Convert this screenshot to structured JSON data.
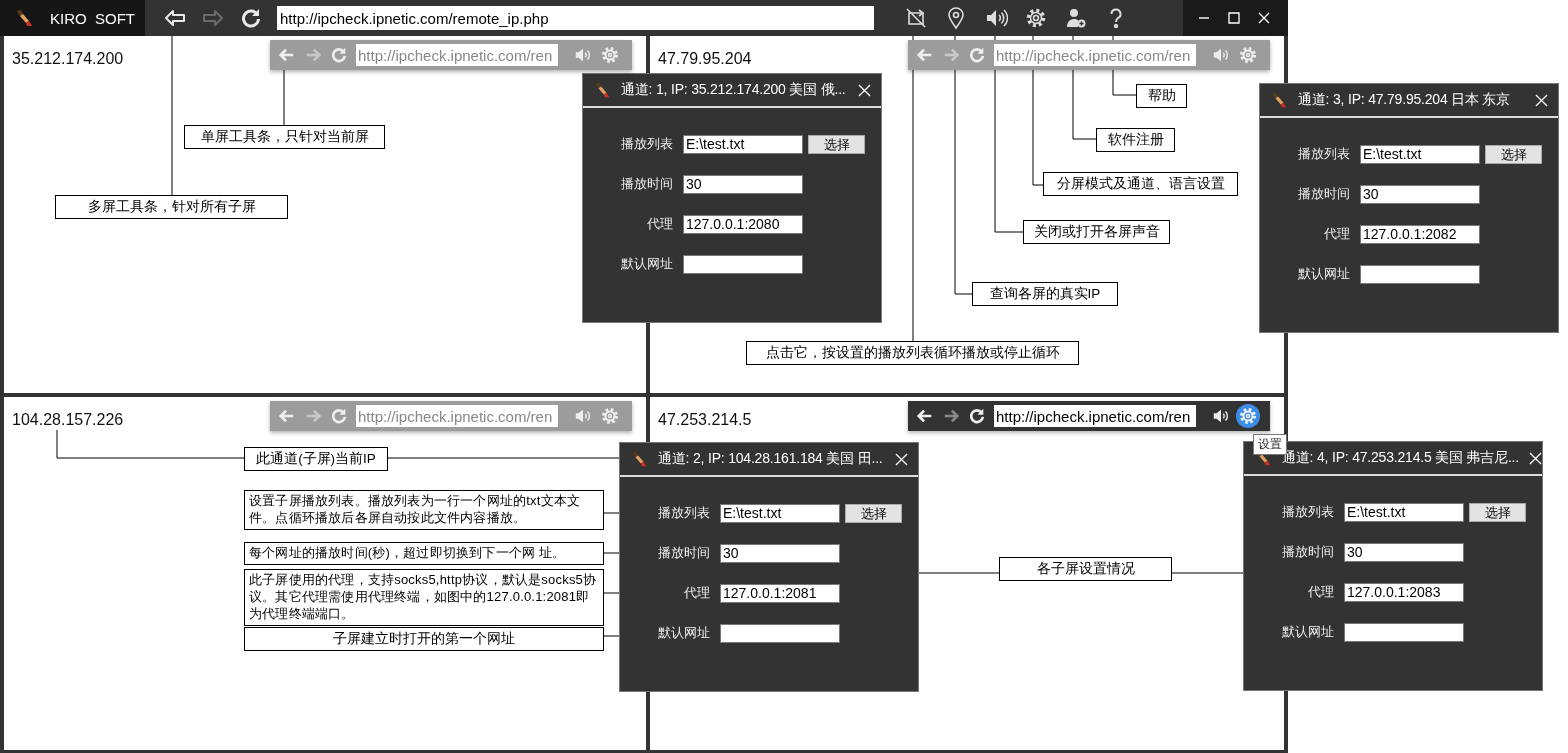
{
  "app": {
    "title": "KIRO  SOFT"
  },
  "toolbar": {
    "nav": [
      {
        "kind": "back",
        "disabled": false
      },
      {
        "kind": "forward",
        "disabled": true
      },
      {
        "kind": "reload",
        "disabled": false
      }
    ],
    "url": "http://ipcheck.ipnetic.com/remote_ip.php",
    "tools": [
      {
        "kind": "loop"
      },
      {
        "kind": "ip"
      },
      {
        "kind": "sound"
      },
      {
        "kind": "settings"
      },
      {
        "kind": "register"
      },
      {
        "kind": "help"
      }
    ],
    "window_controls": [
      {
        "kind": "minimize"
      },
      {
        "kind": "maximize"
      },
      {
        "kind": "close"
      }
    ]
  },
  "panes": [
    {
      "ip": "35.212.174.200",
      "toolbar": {
        "url": "http://ipcheck.ipnetic.com/ren",
        "active": false,
        "settings_highlighted": false
      },
      "dialog": {
        "title": "通道: 1, IP: 35.212.174.200 美国 俄...",
        "fields": [
          {
            "label": "播放列表",
            "value": "E:\\test.txt",
            "button": "选择"
          },
          {
            "label": "播放时间",
            "value": "30"
          },
          {
            "label": "代理",
            "value": "127.0.0.1:2080"
          },
          {
            "label": "默认网址"
          }
        ]
      }
    },
    {
      "ip": "47.79.95.204",
      "toolbar": {
        "url": "http://ipcheck.ipnetic.com/ren",
        "active": false,
        "settings_highlighted": false
      },
      "dialog": {
        "title": "通道: 3, IP: 47.79.95.204 日本 东京",
        "fields": [
          {
            "label": "播放列表",
            "value": "E:\\test.txt",
            "button": "选择"
          },
          {
            "label": "播放时间",
            "value": "30"
          },
          {
            "label": "代理",
            "value": "127.0.0.1:2082"
          },
          {
            "label": "默认网址"
          }
        ]
      }
    },
    {
      "ip": "104.28.157.226",
      "toolbar": {
        "url": "http://ipcheck.ipnetic.com/ren",
        "active": false,
        "settings_highlighted": false
      },
      "dialog": {
        "title": "通道: 2, IP: 104.28.161.184 美国 田...",
        "fields": [
          {
            "label": "播放列表",
            "value": "E:\\test.txt",
            "button": "选择"
          },
          {
            "label": "播放时间",
            "value": "30"
          },
          {
            "label": "代理",
            "value": "127.0.0.1:2081"
          },
          {
            "label": "默认网址"
          }
        ]
      }
    },
    {
      "ip": "47.253.214.5",
      "toolbar": {
        "url": "http://ipcheck.ipnetic.com/ren",
        "active": true,
        "settings_highlighted": true,
        "tooltip": "设置"
      },
      "dialog": {
        "title": "通道: 4, IP: 47.253.214.5 美国 弗吉尼...",
        "fields": [
          {
            "label": "播放列表",
            "value": "E:\\test.txt",
            "button": "选择"
          },
          {
            "label": "播放时间",
            "value": "30"
          },
          {
            "label": "代理",
            "value": "127.0.0.1:2083"
          },
          {
            "label": "默认网址"
          }
        ]
      }
    }
  ],
  "callouts": [
    {
      "text": "单屏工具条，只针对当前屏"
    },
    {
      "text": "多屏工具条，针对所有子屏"
    },
    {
      "text": "帮助"
    },
    {
      "text": "软件注册"
    },
    {
      "text": "分屏模式及通道、语言设置"
    },
    {
      "text": "关闭或打开各屏声音"
    },
    {
      "text": "查询各屏的真实IP"
    },
    {
      "text": "点击它，按设置的播放列表循环播放或停止循环"
    },
    {
      "text": "此通道(子屏)当前IP"
    },
    {
      "text": "设置子屏播放列表。播放列表为一行一个网址的txt文本文件。点循环播放后各屏自动按此文件内容播放。"
    },
    {
      "text": "每个网址的播放时间(秒)，超过即切换到下一个网 址。"
    },
    {
      "text": "此子屏使用的代理，支持socks5,http协议，默认是socks5协议。其它代理需使用代理终端，如图中的127.0.0.1:2081即为代理终端端口。"
    },
    {
      "text": "子屏建立时打开的第一个网址"
    },
    {
      "text": "各子屏设置情况"
    }
  ]
}
